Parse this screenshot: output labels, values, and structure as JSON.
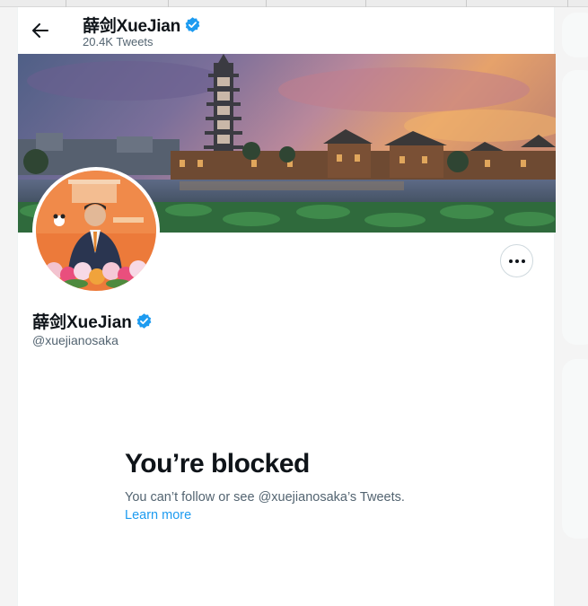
{
  "header": {
    "title": "薛剑XueJian",
    "tweet_count": "20.4K Tweets"
  },
  "profile": {
    "name": "薛剑XueJian",
    "handle": "@xuejianosaka"
  },
  "blocked": {
    "title": "You’re blocked",
    "description": "You can’t follow or see @xuejianosaka’s Tweets.",
    "learn_more": "Learn more"
  },
  "colors": {
    "accent": "#1d9bf0",
    "text_primary": "#0f1419",
    "text_secondary": "#536471"
  },
  "icons": {
    "back": "arrow-left-icon",
    "verified": "verified-badge-icon",
    "more": "more-horizontal-icon"
  }
}
